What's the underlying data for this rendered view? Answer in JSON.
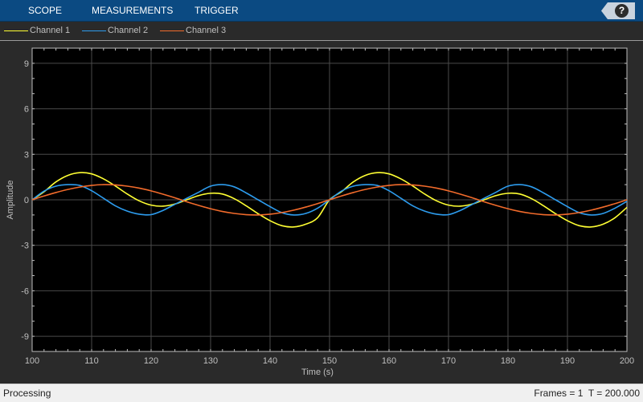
{
  "toolstrip": {
    "tabs": [
      {
        "label": "SCOPE"
      },
      {
        "label": "MEASUREMENTS"
      },
      {
        "label": "TRIGGER"
      }
    ],
    "help_label": "?"
  },
  "legend": {
    "items": [
      {
        "label": "Channel 1",
        "color": "#ffff33"
      },
      {
        "label": "Channel 2",
        "color": "#2d9cee"
      },
      {
        "label": "Channel 3",
        "color": "#f26b2b"
      }
    ]
  },
  "chart_data": {
    "type": "line",
    "xlabel": "Time (s)",
    "ylabel": "Amplitude",
    "xlim": [
      100,
      200
    ],
    "ylim": [
      -10,
      10
    ],
    "xticks": [
      100,
      110,
      120,
      130,
      140,
      150,
      160,
      170,
      180,
      190,
      200
    ],
    "yticks": [
      9,
      6,
      3,
      0,
      -3,
      -6,
      -9
    ],
    "grid": true,
    "background": "#000000",
    "series": [
      {
        "name": "Channel 1",
        "color": "#ffff33",
        "x": [
          100,
          102,
          104,
          106,
          108,
          110,
          112,
          114,
          116,
          118,
          120,
          122,
          124,
          126,
          128,
          130,
          132,
          134,
          136,
          138,
          140,
          142,
          144,
          146,
          148,
          150,
          152,
          154,
          156,
          158,
          160,
          162,
          164,
          166,
          168,
          170,
          172,
          174,
          176,
          178,
          180,
          182,
          184,
          186,
          188,
          190,
          192,
          194,
          196,
          198,
          200
        ],
        "y": [
          0,
          0.53,
          1.18,
          1.61,
          1.79,
          1.71,
          1.38,
          0.91,
          0.38,
          -0.07,
          -0.35,
          -0.42,
          -0.28,
          0,
          0.28,
          0.43,
          0.38,
          0.07,
          -0.4,
          -0.92,
          -1.38,
          -1.71,
          -1.79,
          -1.61,
          -1.18,
          0,
          0.53,
          1.18,
          1.61,
          1.79,
          1.71,
          1.38,
          0.91,
          0.38,
          -0.07,
          -0.35,
          -0.42,
          -0.28,
          0,
          0.28,
          0.43,
          0.38,
          0.07,
          -0.4,
          -0.92,
          -1.38,
          -1.71,
          -1.79,
          -1.61,
          -1.18,
          -0.5
        ]
      },
      {
        "name": "Channel 2",
        "color": "#2d9cee",
        "x": [
          100,
          102,
          104,
          106,
          108,
          110,
          112,
          114,
          116,
          118,
          120,
          122,
          124,
          126,
          128,
          130,
          132,
          134,
          136,
          138,
          140,
          142,
          144,
          146,
          148,
          150,
          152,
          154,
          156,
          158,
          160,
          162,
          164,
          166,
          168,
          170,
          172,
          174,
          176,
          178,
          180,
          182,
          184,
          186,
          188,
          190,
          192,
          194,
          196,
          198,
          200
        ],
        "y": [
          0,
          0.57,
          0.9,
          1.0,
          0.95,
          0.6,
          0.1,
          -0.4,
          -0.75,
          -0.95,
          -0.98,
          -0.7,
          -0.3,
          0.1,
          0.5,
          0.9,
          1.0,
          0.85,
          0.45,
          0,
          -0.45,
          -0.85,
          -1.0,
          -0.9,
          -0.55,
          0,
          0.57,
          0.9,
          1.0,
          0.95,
          0.6,
          0.1,
          -0.4,
          -0.75,
          -0.95,
          -0.98,
          -0.7,
          -0.3,
          0.1,
          0.5,
          0.9,
          1.0,
          0.85,
          0.45,
          0,
          -0.45,
          -0.85,
          -1.0,
          -0.9,
          -0.55,
          -0.1
        ]
      },
      {
        "name": "Channel 3",
        "color": "#f26b2b",
        "x": [
          100,
          102,
          104,
          106,
          108,
          110,
          112,
          114,
          116,
          118,
          120,
          122,
          124,
          126,
          128,
          130,
          132,
          134,
          136,
          138,
          140,
          142,
          144,
          146,
          148,
          150,
          152,
          154,
          156,
          158,
          160,
          162,
          164,
          166,
          168,
          170,
          172,
          174,
          176,
          178,
          180,
          182,
          184,
          186,
          188,
          190,
          192,
          194,
          196,
          198,
          200
        ],
        "y": [
          0,
          0.25,
          0.48,
          0.68,
          0.84,
          0.95,
          1.0,
          0.98,
          0.9,
          0.77,
          0.59,
          0.37,
          0.13,
          -0.13,
          -0.37,
          -0.59,
          -0.77,
          -0.9,
          -0.98,
          -1.0,
          -0.95,
          -0.84,
          -0.68,
          -0.48,
          -0.25,
          0,
          0.25,
          0.48,
          0.68,
          0.84,
          0.95,
          1.0,
          0.98,
          0.9,
          0.77,
          0.59,
          0.37,
          0.13,
          -0.13,
          -0.37,
          -0.59,
          -0.77,
          -0.9,
          -0.98,
          -1.0,
          -0.95,
          -0.84,
          -0.68,
          -0.48,
          -0.25,
          0
        ]
      }
    ]
  },
  "status": {
    "left": "Processing",
    "right": "Frames = 1  T = 200.000"
  }
}
